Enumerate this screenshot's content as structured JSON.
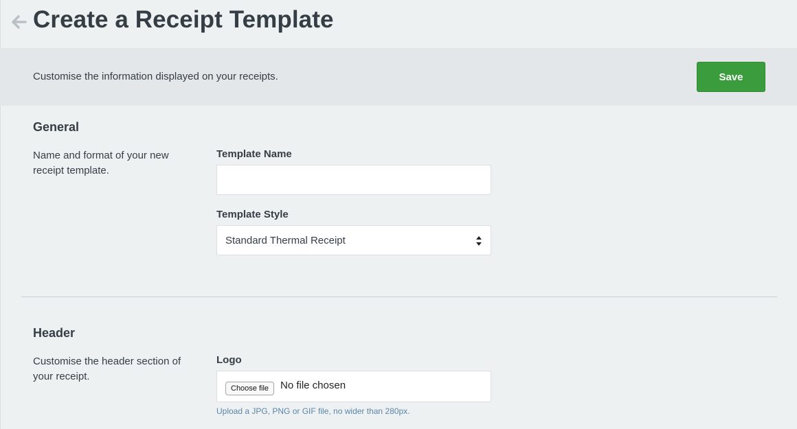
{
  "header": {
    "title": "Create a Receipt Template",
    "back_icon": "arrow-left-icon"
  },
  "banner": {
    "text": "Customise the information displayed on your receipts.",
    "save_label": "Save",
    "save_color": "#3a9c3c"
  },
  "general": {
    "title": "General",
    "description": "Name and format of your new receipt template.",
    "template_name": {
      "label": "Template Name",
      "value": "",
      "placeholder": ""
    },
    "template_style": {
      "label": "Template Style",
      "selected": "Standard Thermal Receipt"
    }
  },
  "header_section": {
    "title": "Header",
    "description": "Customise the header section of your receipt.",
    "logo": {
      "label": "Logo",
      "button_label": "Choose file",
      "status": "No file chosen",
      "help": "Upload a JPG, PNG or GIF file, no wider than 280px."
    }
  }
}
